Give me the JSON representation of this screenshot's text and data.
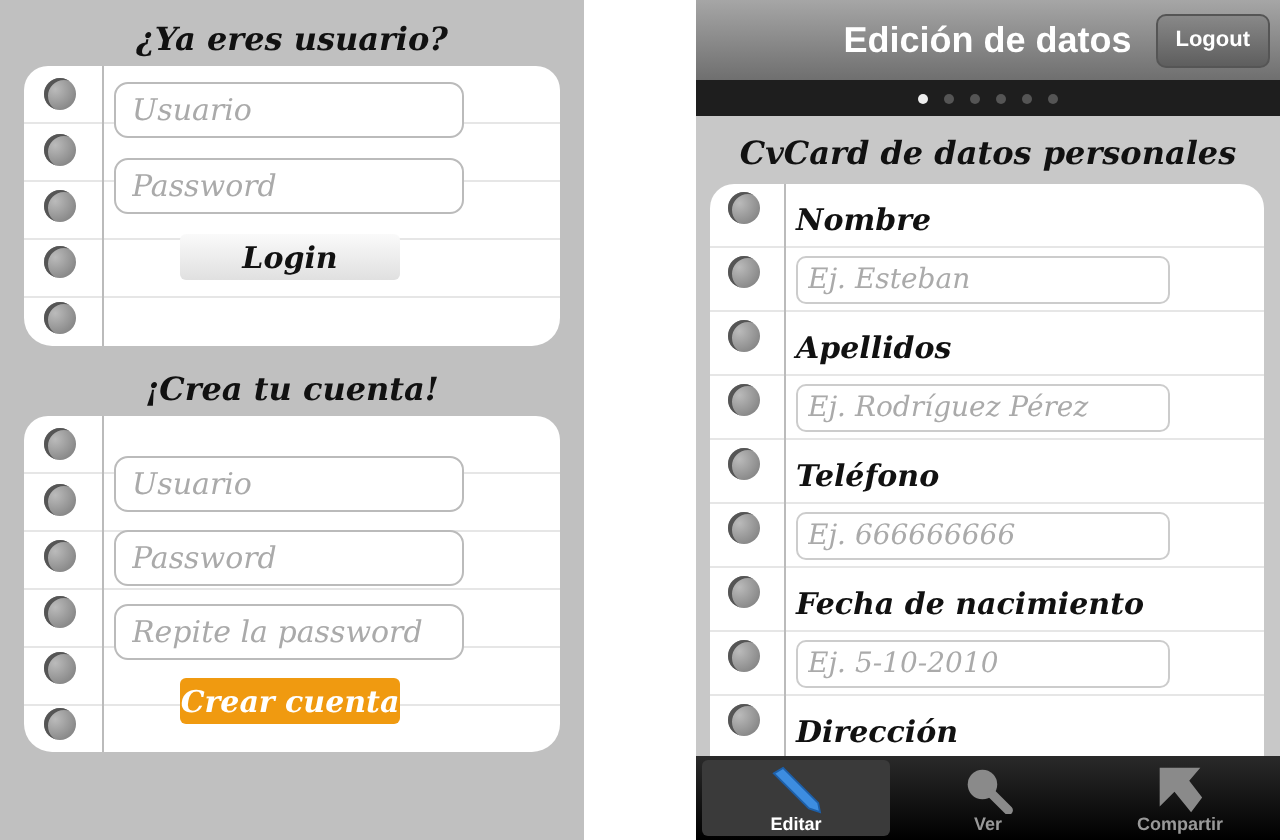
{
  "login_screen": {
    "sections": [
      {
        "title": "¿Ya eres usuario?",
        "fields": [
          {
            "placeholder": "Usuario"
          },
          {
            "placeholder": "Password"
          }
        ],
        "button": {
          "label": "Login",
          "kind": "plain"
        }
      },
      {
        "title": "¡Crea tu cuenta!",
        "fields": [
          {
            "placeholder": "Usuario"
          },
          {
            "placeholder": "Password"
          },
          {
            "placeholder": "Repite la password"
          }
        ],
        "button": {
          "label": "Crear cuenta",
          "kind": "primary"
        }
      }
    ]
  },
  "edit_screen": {
    "nav_bar": {
      "title": "Edición de datos",
      "button": "Logout"
    },
    "page_dots": [
      {
        "selected": true
      },
      {
        "selected": false
      },
      {
        "selected": false
      },
      {
        "selected": false
      },
      {
        "selected": false
      },
      {
        "selected": false
      }
    ],
    "heading": "CvCard de datos personales",
    "form": [
      {
        "label": "Nombre",
        "placeholder": "Ej. Esteban"
      },
      {
        "label": "Apellidos",
        "placeholder": "Ej. Rodríguez Pérez"
      },
      {
        "label": "Teléfono",
        "placeholder": "Ej. 666666666"
      },
      {
        "label": "Fecha de nacimiento",
        "placeholder": "Ej. 5-10-2010"
      },
      {
        "label": "Dirección"
      }
    ],
    "tab_bar": [
      {
        "label": "Editar",
        "selected": true
      },
      {
        "label": "Ver",
        "selected": false
      },
      {
        "label": "Compartir",
        "selected": false
      }
    ]
  }
}
